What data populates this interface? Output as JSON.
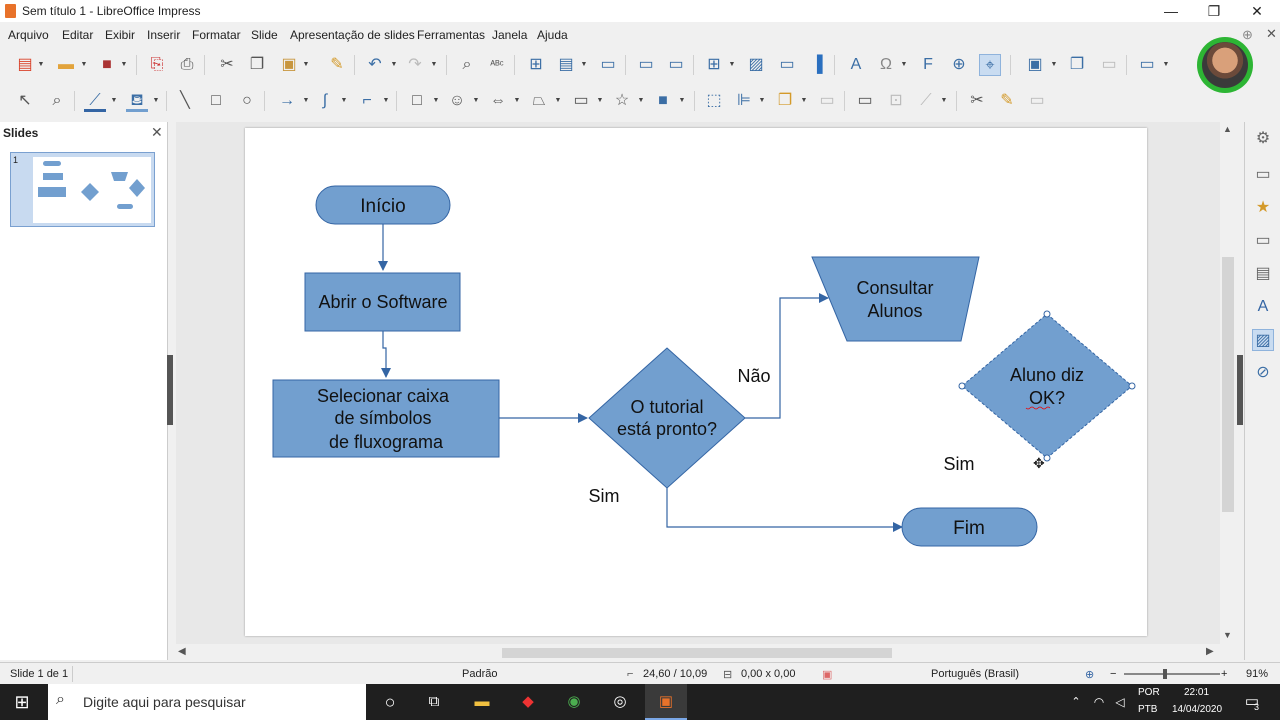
{
  "window": {
    "title": "Sem título 1 - LibreOffice Impress",
    "minimize": "—",
    "restore": "❐",
    "close": "✕"
  },
  "menu": [
    "Arquivo",
    "Editar",
    "Exibir",
    "Inserir",
    "Formatar",
    "Slide",
    "Apresentação de slides",
    "Ferramentas",
    "Janela",
    "Ajuda"
  ],
  "slide_pane": {
    "header": "Slides",
    "thumb_number": "1"
  },
  "flowchart": {
    "start": "Início",
    "open": "Abrir o Software",
    "select_line1": "Selecionar caixa",
    "select_line2": "de símbolos",
    "select_line3": "de fluxograma",
    "decision_line1": "O tutorial",
    "decision_line2": "está pronto?",
    "no_label": "Não",
    "yes_label": "Sim",
    "consult_line1": "Consultar",
    "consult_line2": "Alunos",
    "student_line1": "Aluno diz",
    "student_line2": "OK?",
    "yes2_label": "Sim",
    "end": "Fim",
    "shape_fill": "#729fcf",
    "shape_stroke": "#3465a4"
  },
  "status": {
    "slide": "Slide 1 de 1",
    "layout": "Padrão",
    "position": "24,60 / 10,09",
    "size": "0,00 x 0,00",
    "language": "Português (Brasil)",
    "zoom": "91%"
  },
  "taskbar": {
    "search_placeholder": "Digite aqui para pesquisar",
    "lang1": "POR",
    "lang2": "PTB",
    "time": "22:01",
    "date": "14/04/2020",
    "notifications": "3"
  }
}
